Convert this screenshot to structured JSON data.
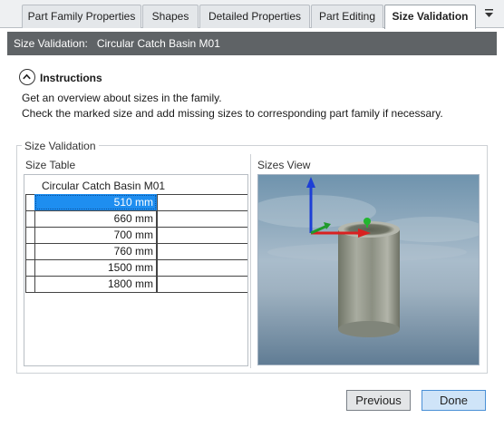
{
  "tabs": [
    {
      "label": "Part Family Properties"
    },
    {
      "label": "Shapes"
    },
    {
      "label": "Detailed Properties"
    },
    {
      "label": "Part Editing"
    },
    {
      "label": "Size Validation"
    }
  ],
  "active_tab": "Size Validation",
  "header": {
    "label": "Size Validation:",
    "value": "Circular Catch Basin M01"
  },
  "instructions": {
    "title": "Instructions",
    "lines": [
      "Get an overview about sizes in the family.",
      "Check the marked size and add missing sizes to corresponding part family if necessary."
    ]
  },
  "group": {
    "title": "Size Validation",
    "size_table_label": "Size Table",
    "sizes_view_label": "Sizes View"
  },
  "size_table": {
    "column_header": "Circular Catch Basin M01",
    "rows": [
      "510 mm",
      "660 mm",
      "700 mm",
      "760 mm",
      "1500 mm",
      "1800 mm"
    ],
    "selected_index": 0
  },
  "buttons": {
    "previous": "Previous",
    "done": "Done"
  },
  "colors": {
    "header_bg": "#5f6366",
    "selection": "#1e8ef0",
    "done_bg": "#cfe4f8"
  },
  "icons": {
    "collapse": "chevron-up-in-circle",
    "tab_menu": "menu-dropdown"
  }
}
